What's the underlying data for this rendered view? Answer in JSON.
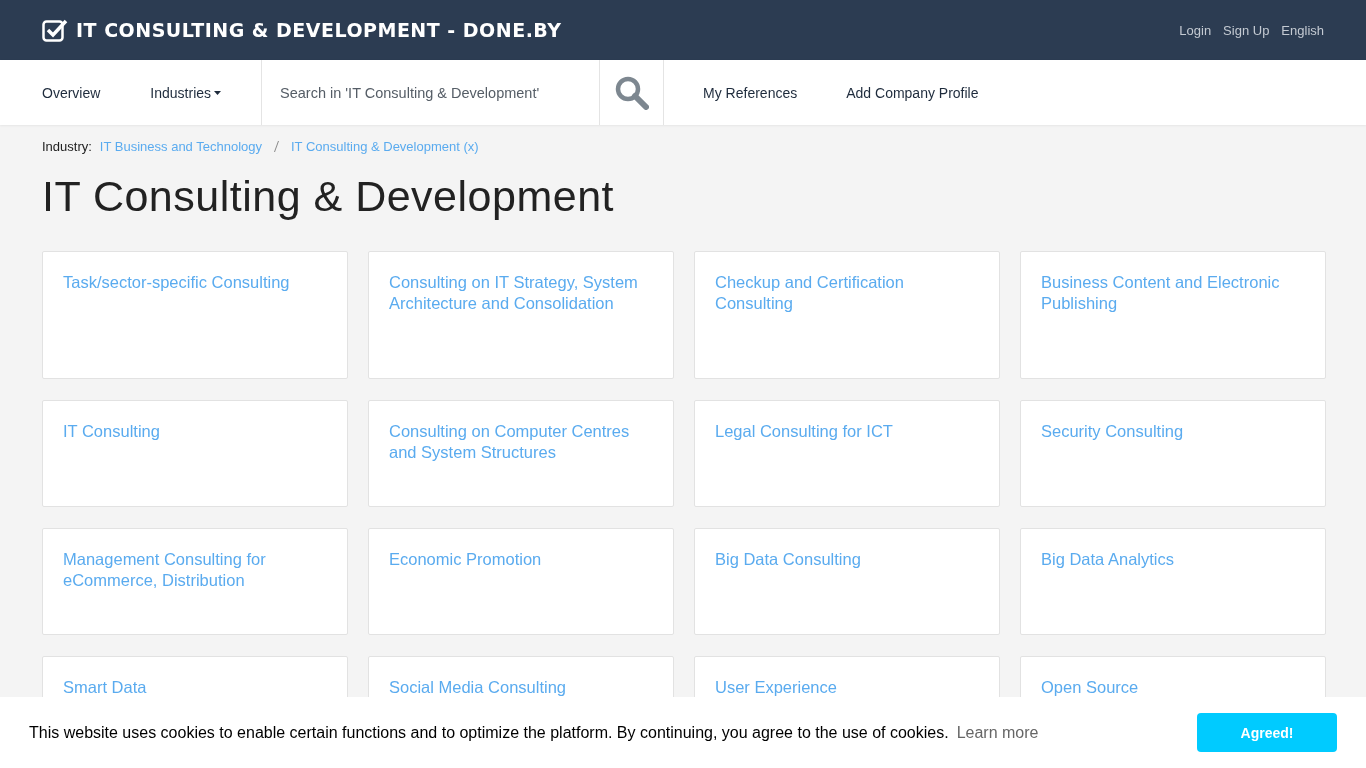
{
  "header": {
    "brand": "IT CONSULTING & DEVELOPMENT - DONE.BY",
    "links": [
      "Login",
      "Sign Up",
      "English"
    ]
  },
  "nav": {
    "left": [
      {
        "label": "Overview",
        "dropdown": false
      },
      {
        "label": "Industries",
        "dropdown": true
      }
    ],
    "search": {
      "placeholder": "Search in 'IT Consulting & Development'"
    },
    "right": [
      "My References",
      "Add Company Profile"
    ]
  },
  "breadcrumb": {
    "label": "Industry:",
    "links": [
      "IT Business and Technology",
      "IT Consulting & Development (x)"
    ]
  },
  "title": "IT Consulting & Development",
  "cards": [
    {
      "title": "Task/sector-specific Consulting"
    },
    {
      "title": "Consulting on IT Strategy, System Architecture and Consolidation"
    },
    {
      "title": "Checkup and Certification Consulting"
    },
    {
      "title": "Business Content and Electronic Publishing"
    },
    {
      "title": "IT Consulting"
    },
    {
      "title": "Consulting on Computer Centres and System Structures"
    },
    {
      "title": "Legal Consulting for ICT"
    },
    {
      "title": "Security Consulting"
    },
    {
      "title": "Management Consulting for eCommerce, Distribution"
    },
    {
      "title": "Economic Promotion"
    },
    {
      "title": "Big Data Consulting"
    },
    {
      "title": "Big Data Analytics"
    },
    {
      "title": "Smart Data"
    },
    {
      "title": "Social Media Consulting"
    },
    {
      "title": "User Experience"
    },
    {
      "title": "Open Source"
    }
  ],
  "cookie_bar": {
    "text": "This website uses cookies to enable certain functions and to optimize the platform. By continuing, you agree to the use of cookies.",
    "link": "Learn more",
    "button": "Agreed!"
  }
}
